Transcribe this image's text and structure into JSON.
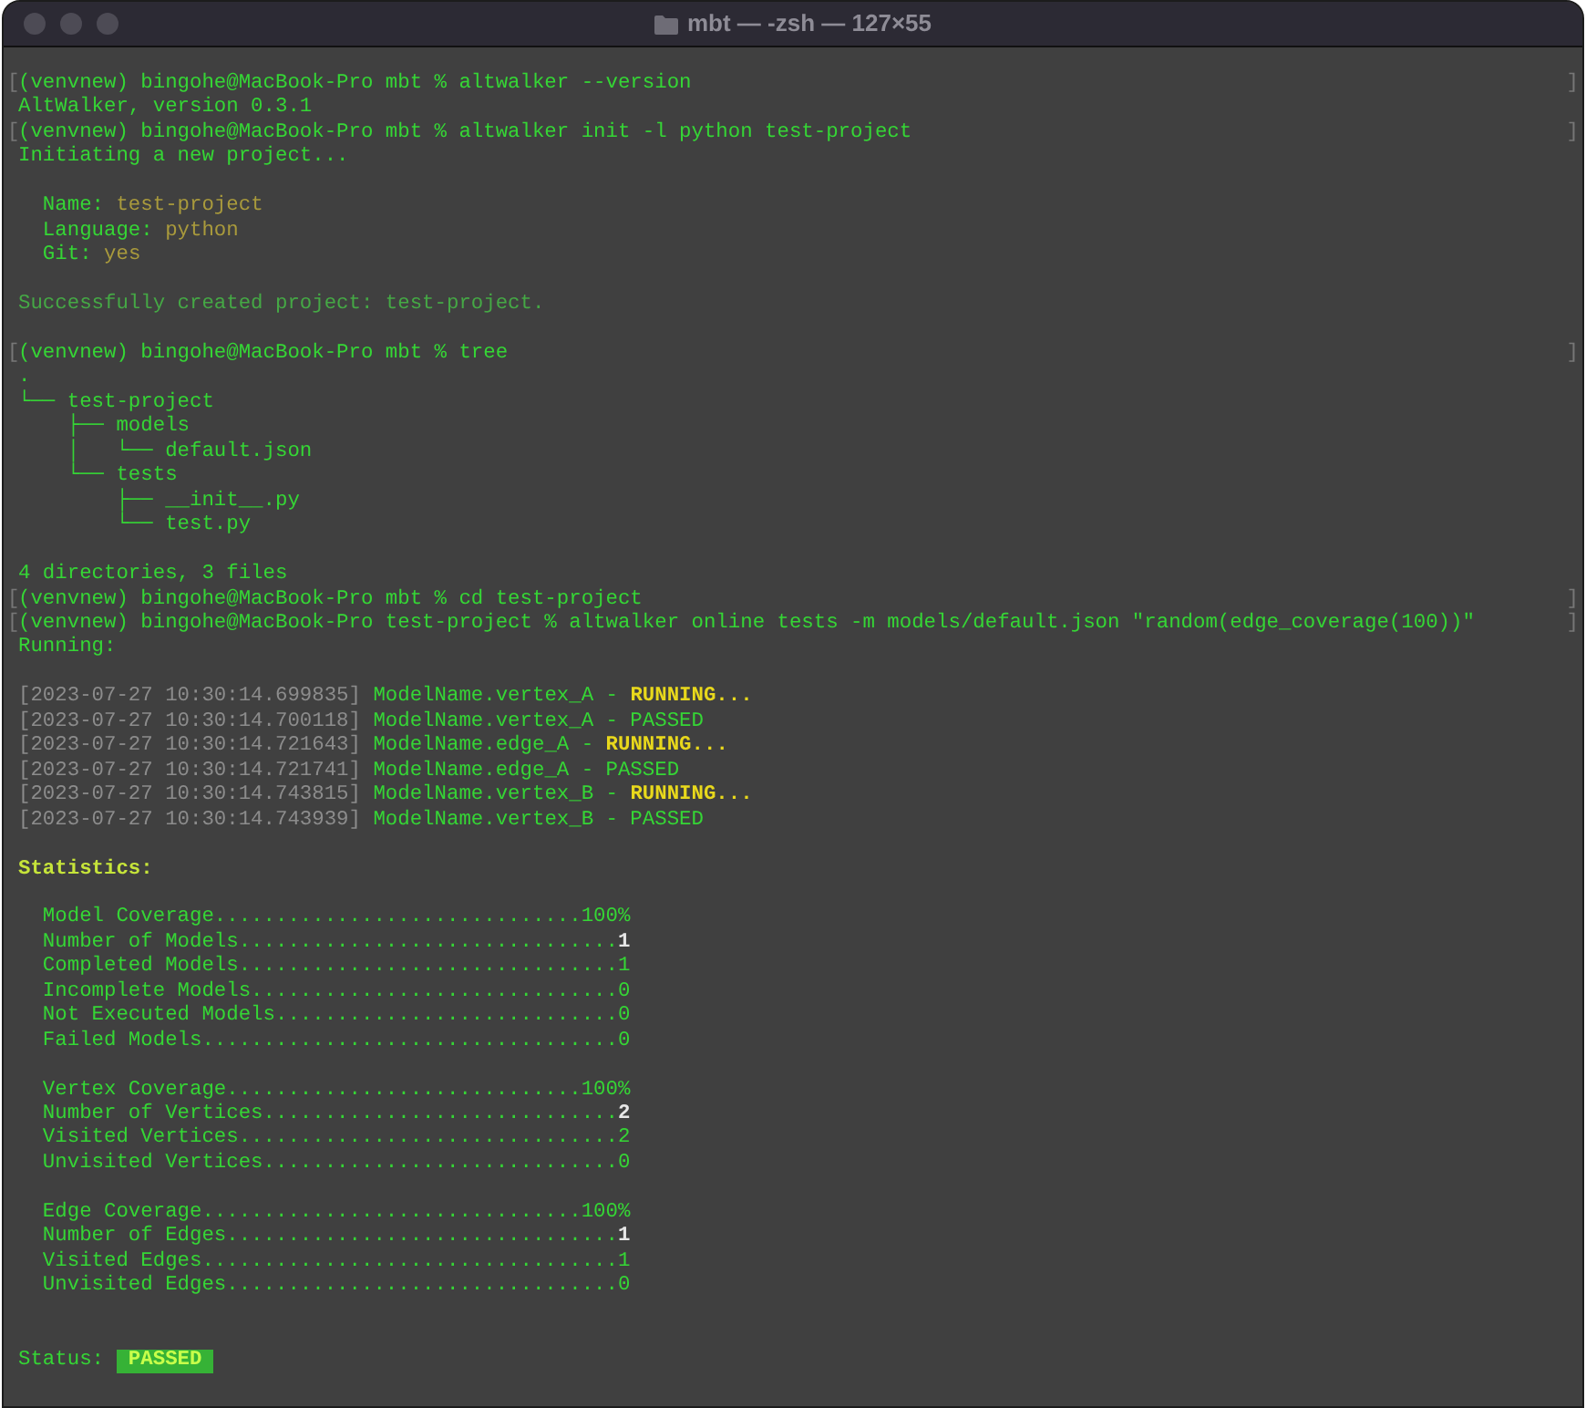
{
  "window": {
    "title": "mbt — -zsh — 127×55"
  },
  "lines": [
    {
      "kind": "prompt",
      "mark": "[",
      "end_mark": "]",
      "segments": [
        {
          "text": "(venvnew) bingohe@MacBook-Pro mbt % altwalker --version",
          "kind": "output"
        }
      ]
    },
    {
      "kind": "text",
      "segments": [
        {
          "text": "AltWalker, version 0.3.1",
          "kind": "output"
        }
      ]
    },
    {
      "kind": "prompt",
      "mark": "[",
      "end_mark": "]",
      "segments": [
        {
          "text": "(venvnew) bingohe@MacBook-Pro mbt % altwalker init -l python test-project",
          "kind": "output"
        }
      ]
    },
    {
      "kind": "text",
      "segments": [
        {
          "text": "Initiating a new project...",
          "kind": "output"
        }
      ]
    },
    {
      "kind": "blank"
    },
    {
      "kind": "text",
      "segments": [
        {
          "text": "  Name:",
          "kind": "output"
        },
        {
          "text": " test-project",
          "kind": "value"
        }
      ]
    },
    {
      "kind": "text",
      "segments": [
        {
          "text": "  Language:",
          "kind": "output"
        },
        {
          "text": " python",
          "kind": "value"
        }
      ]
    },
    {
      "kind": "text",
      "segments": [
        {
          "text": "  Git:",
          "kind": "output"
        },
        {
          "text": " yes",
          "kind": "value"
        }
      ]
    },
    {
      "kind": "blank"
    },
    {
      "kind": "text",
      "segments": [
        {
          "text": "Successfully created project: test-project.",
          "kind": "notice"
        }
      ]
    },
    {
      "kind": "blank"
    },
    {
      "kind": "prompt",
      "mark": "[",
      "end_mark": "]",
      "segments": [
        {
          "text": "(venvnew) bingohe@MacBook-Pro mbt % tree",
          "kind": "output"
        }
      ]
    },
    {
      "kind": "text",
      "segments": [
        {
          "text": ".",
          "kind": "output"
        }
      ]
    },
    {
      "kind": "text",
      "segments": [
        {
          "text": "└── test-project",
          "kind": "output"
        }
      ]
    },
    {
      "kind": "text",
      "segments": [
        {
          "text": "    ├── models",
          "kind": "output"
        }
      ]
    },
    {
      "kind": "text",
      "segments": [
        {
          "text": "    │   └── default.json",
          "kind": "output"
        }
      ]
    },
    {
      "kind": "text",
      "segments": [
        {
          "text": "    └── tests",
          "kind": "output"
        }
      ]
    },
    {
      "kind": "text",
      "segments": [
        {
          "text": "        ├── __init__.py",
          "kind": "output"
        }
      ]
    },
    {
      "kind": "text",
      "segments": [
        {
          "text": "        └── test.py",
          "kind": "output"
        }
      ]
    },
    {
      "kind": "blank"
    },
    {
      "kind": "text",
      "segments": [
        {
          "text": "4 directories, 3 files",
          "kind": "output"
        }
      ]
    },
    {
      "kind": "prompt",
      "mark": "[",
      "end_mark": "]",
      "segments": [
        {
          "text": "(venvnew) bingohe@MacBook-Pro mbt % cd test-project",
          "kind": "output"
        }
      ]
    },
    {
      "kind": "prompt",
      "mark": "[",
      "end_mark": "]",
      "segments": [
        {
          "text": "(venvnew) bingohe@MacBook-Pro test-project % altwalker online tests -m models/default.json \"random(edge_coverage(100))\"",
          "kind": "output"
        }
      ]
    },
    {
      "kind": "text",
      "segments": [
        {
          "text": "Running:",
          "kind": "output"
        }
      ]
    },
    {
      "kind": "blank"
    },
    {
      "kind": "text",
      "segments": [
        {
          "text": "[2023-07-27 10:30:14.699835]",
          "kind": "timestamp"
        },
        {
          "text": " ModelName.vertex_A - ",
          "kind": "output"
        },
        {
          "text": "RUNNING...",
          "kind": "running"
        }
      ]
    },
    {
      "kind": "text",
      "segments": [
        {
          "text": "[2023-07-27 10:30:14.700118]",
          "kind": "timestamp"
        },
        {
          "text": " ModelName.vertex_A - PASSED",
          "kind": "output"
        }
      ]
    },
    {
      "kind": "text",
      "segments": [
        {
          "text": "[2023-07-27 10:30:14.721643]",
          "kind": "timestamp"
        },
        {
          "text": " ModelName.edge_A - ",
          "kind": "output"
        },
        {
          "text": "RUNNING...",
          "kind": "running"
        }
      ]
    },
    {
      "kind": "text",
      "segments": [
        {
          "text": "[2023-07-27 10:30:14.721741]",
          "kind": "timestamp"
        },
        {
          "text": " ModelName.edge_A - PASSED",
          "kind": "output"
        }
      ]
    },
    {
      "kind": "text",
      "segments": [
        {
          "text": "[2023-07-27 10:30:14.743815]",
          "kind": "timestamp"
        },
        {
          "text": " ModelName.vertex_B - ",
          "kind": "output"
        },
        {
          "text": "RUNNING...",
          "kind": "running"
        }
      ]
    },
    {
      "kind": "text",
      "segments": [
        {
          "text": "[2023-07-27 10:30:14.743939]",
          "kind": "timestamp"
        },
        {
          "text": " ModelName.vertex_B - PASSED",
          "kind": "output"
        }
      ]
    },
    {
      "kind": "blank"
    },
    {
      "kind": "text",
      "segments": [
        {
          "text": "Statistics:",
          "kind": "heading"
        }
      ]
    },
    {
      "kind": "blank"
    },
    {
      "kind": "text",
      "segments": [
        {
          "text": "  Model Coverage..............................",
          "kind": "output"
        },
        {
          "text": "100%",
          "kind": "output"
        }
      ]
    },
    {
      "kind": "text",
      "segments": [
        {
          "text": "  Number of Models...............................",
          "kind": "output"
        },
        {
          "text": "1",
          "kind": "count"
        }
      ]
    },
    {
      "kind": "text",
      "segments": [
        {
          "text": "  Completed Models...............................",
          "kind": "output"
        },
        {
          "text": "1",
          "kind": "output"
        }
      ]
    },
    {
      "kind": "text",
      "segments": [
        {
          "text": "  Incomplete Models..............................",
          "kind": "output"
        },
        {
          "text": "0",
          "kind": "output"
        }
      ]
    },
    {
      "kind": "text",
      "segments": [
        {
          "text": "  Not Executed Models............................",
          "kind": "output"
        },
        {
          "text": "0",
          "kind": "output"
        }
      ]
    },
    {
      "kind": "text",
      "segments": [
        {
          "text": "  Failed Models..................................",
          "kind": "output"
        },
        {
          "text": "0",
          "kind": "output"
        }
      ]
    },
    {
      "kind": "blank"
    },
    {
      "kind": "text",
      "segments": [
        {
          "text": "  Vertex Coverage.............................",
          "kind": "output"
        },
        {
          "text": "100%",
          "kind": "output"
        }
      ]
    },
    {
      "kind": "text",
      "segments": [
        {
          "text": "  Number of Vertices.............................",
          "kind": "output"
        },
        {
          "text": "2",
          "kind": "count"
        }
      ]
    },
    {
      "kind": "text",
      "segments": [
        {
          "text": "  Visited Vertices...............................",
          "kind": "output"
        },
        {
          "text": "2",
          "kind": "output"
        }
      ]
    },
    {
      "kind": "text",
      "segments": [
        {
          "text": "  Unvisited Vertices.............................",
          "kind": "output"
        },
        {
          "text": "0",
          "kind": "output"
        }
      ]
    },
    {
      "kind": "blank"
    },
    {
      "kind": "text",
      "segments": [
        {
          "text": "  Edge Coverage...............................",
          "kind": "output"
        },
        {
          "text": "100%",
          "kind": "output"
        }
      ]
    },
    {
      "kind": "text",
      "segments": [
        {
          "text": "  Number of Edges................................",
          "kind": "output"
        },
        {
          "text": "1",
          "kind": "count"
        }
      ]
    },
    {
      "kind": "text",
      "segments": [
        {
          "text": "  Visited Edges..................................",
          "kind": "output"
        },
        {
          "text": "1",
          "kind": "output"
        }
      ]
    },
    {
      "kind": "text",
      "segments": [
        {
          "text": "  Unvisited Edges................................",
          "kind": "output"
        },
        {
          "text": "0",
          "kind": "output"
        }
      ]
    },
    {
      "kind": "blank"
    },
    {
      "kind": "blank"
    },
    {
      "kind": "text",
      "segments": [
        {
          "text": "Status: ",
          "kind": "output"
        },
        {
          "text": " PASSED ",
          "kind": "badge"
        }
      ]
    }
  ]
}
